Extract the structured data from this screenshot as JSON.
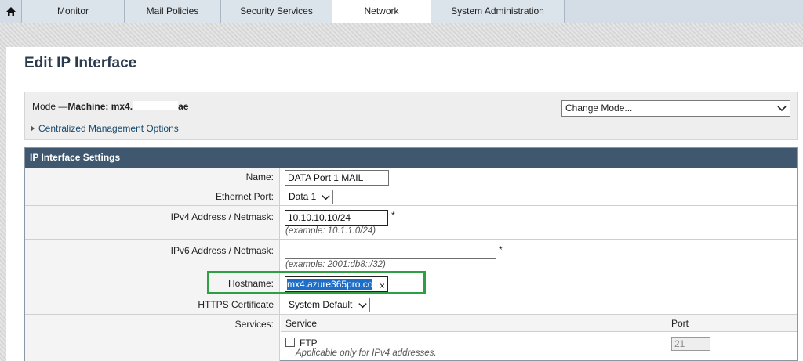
{
  "nav": {
    "home_icon": "home-icon",
    "tabs": [
      "Monitor",
      "Mail Policies",
      "Security Services",
      "Network",
      "System Administration"
    ],
    "active": "Network"
  },
  "page_title": "Edit IP Interface",
  "mode": {
    "prefix": "Mode —",
    "machine_label": "Machine: mx4.",
    "machine_suffix": "ae",
    "central_link": "Centralized Management Options",
    "change_mode": "Change Mode..."
  },
  "panel": {
    "title": "IP Interface Settings",
    "name_label": "Name:",
    "name_value": "DATA Port 1 MAIL",
    "eth_label": "Ethernet Port:",
    "eth_value": "Data 1",
    "ipv4_label": "IPv4 Address / Netmask:",
    "ipv4_value": "10.10.10.10/24",
    "ipv4_hint": "(example: 10.1.1.0/24)",
    "ipv6_label": "IPv6 Address / Netmask:",
    "ipv6_value": "",
    "ipv6_hint": "(example: 2001:db8::/32)",
    "required_mark": "*",
    "hostname_label": "Hostname:",
    "hostname_value": "mx4.azure365pro.co",
    "clear_icon": "×",
    "https_label": "HTTPS Certificate",
    "https_value": "System Default",
    "services_label": "Services:",
    "service_col": "Service",
    "port_col": "Port",
    "ftp_label": "FTP",
    "ftp_note": "Applicable only for IPv4 addresses.",
    "ftp_port": "21"
  }
}
